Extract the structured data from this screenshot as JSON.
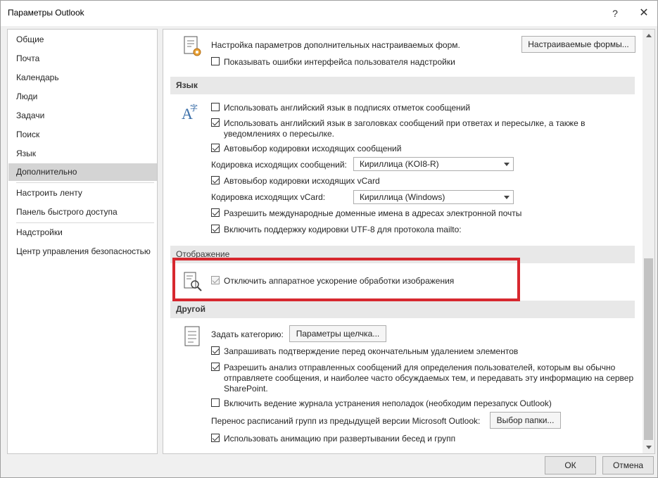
{
  "window": {
    "title": "Параметры Outlook",
    "help_label": "?",
    "close_label": "✕"
  },
  "sidebar": {
    "items": [
      {
        "label": "Общие"
      },
      {
        "label": "Почта"
      },
      {
        "label": "Календарь"
      },
      {
        "label": "Люди"
      },
      {
        "label": "Задачи"
      },
      {
        "label": "Поиск"
      },
      {
        "label": "Язык"
      },
      {
        "label": "Дополнительно",
        "selected": true
      },
      {
        "label": "Настроить ленту"
      },
      {
        "label": "Панель быстрого доступа"
      },
      {
        "label": "Надстройки"
      },
      {
        "label": "Центр управления безопасностью"
      }
    ]
  },
  "forms": {
    "description": "Настройка параметров дополнительных настраиваемых форм.",
    "custom_forms_button": "Настраиваемые формы...",
    "show_addin_errors": {
      "label": "Показывать ошибки интерфейса пользователя надстройки",
      "checked": false
    },
    "icon": "form-settings-icon"
  },
  "language": {
    "header": "Язык",
    "icon": "language-icon",
    "english_flags": {
      "label": "Использовать английский язык в подписях отметок сообщений",
      "checked": false
    },
    "english_headers": {
      "label_line1": "Использовать английский язык в заголовках сообщений при ответах и пересылке, а также в",
      "label_line2": "уведомлениях о пересылке.",
      "checked": true
    },
    "auto_encoding": {
      "label": "Автовыбор кодировки исходящих сообщений",
      "checked": true
    },
    "outgoing_encoding_label": "Кодировка исходящих сообщений:",
    "outgoing_encoding_value": "Кириллица (KOI8-R)",
    "auto_vcard_encoding": {
      "label": "Автовыбор кодировки исходящих vCard",
      "checked": true
    },
    "vcard_encoding_label": "Кодировка исходящих vCard:",
    "vcard_encoding_value": "Кириллица (Windows)",
    "idn": {
      "label": "Разрешить международные доменные имена в адресах электронной почты",
      "checked": true
    },
    "utf8_mailto": {
      "label": "Включить поддержку кодировки UTF-8 для протокола mailto:",
      "checked": true
    }
  },
  "display": {
    "header": "Отображение",
    "icon": "display-search-icon",
    "disable_hw_accel": {
      "label": "Отключить аппаратное ускорение обработки изображения",
      "checked": true,
      "disabled": true
    }
  },
  "other": {
    "header": "Другой",
    "icon": "document-list-icon",
    "category_label": "Задать категорию:",
    "click_options_button": "Параметры щелчка...",
    "confirm_delete": {
      "label": "Запрашивать подтверждение перед окончательным удалением элементов",
      "checked": true
    },
    "analyze_sent": {
      "label_line1": "Разрешить анализ отправленных сообщений для определения пользователей, которым вы обычно",
      "label_line2": "отправляете сообщения, и наиболее часто обсуждаемых тем, и передавать эту информацию на сервер",
      "label_line3": "SharePoint.",
      "checked": true
    },
    "troubleshoot_logging": {
      "label": "Включить ведение журнала устранения неполадок (необходим перезапуск Outlook)",
      "checked": false
    },
    "migrate_schedules_label": "Перенос расписаний групп из предыдущей версии Microsoft Outlook:",
    "select_folder_button": "Выбор папки...",
    "animate_expand": {
      "label": "Использовать анимацию при развертывании бесед и групп",
      "checked": true
    }
  },
  "footer": {
    "ok": "ОК",
    "cancel": "Отмена"
  },
  "colors": {
    "highlight": "#d7282f",
    "selected_nav": "#d4d4d4",
    "section_bg": "#e8e8e8"
  }
}
